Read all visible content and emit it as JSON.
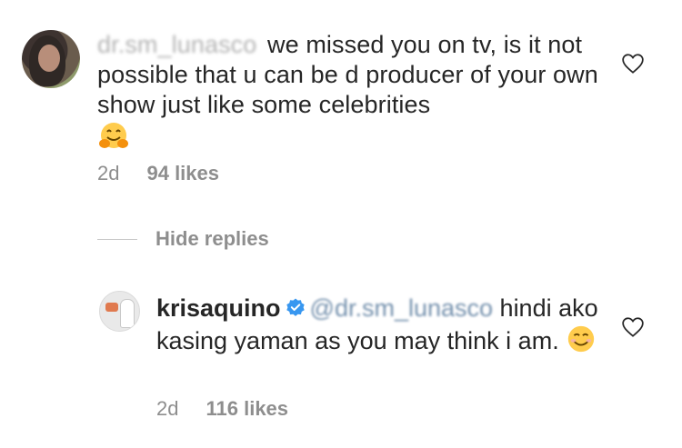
{
  "comment": {
    "mention": "dr.sm_lunasco",
    "text": "we missed you on tv, is it not possible that u can  be d producer of your own show just like some celebrities",
    "emoji": "hugging-face",
    "time": "2d",
    "likes": "94 likes"
  },
  "replies_toggle": {
    "label": "Hide replies"
  },
  "reply": {
    "username": "krisaquino",
    "mention": "@dr.sm_lunasco",
    "text": "hindi ako kasing yaman as you may think i am.",
    "emoji": "smiling-face",
    "time": "2d",
    "likes": "116 likes"
  },
  "colors": {
    "text": "#262626",
    "meta": "#8e8e8e",
    "verified": "#3897f0",
    "mention": "#003569"
  },
  "icons": [
    "heart-outline-icon",
    "verified-badge-icon",
    "hugging-face-emoji",
    "smiling-face-emoji"
  ]
}
